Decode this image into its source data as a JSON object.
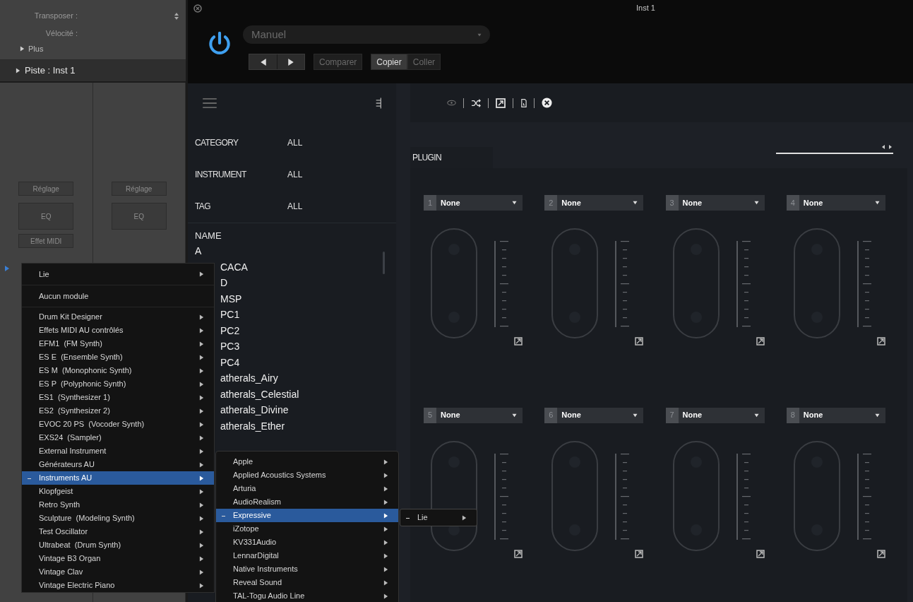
{
  "left_panel": {
    "rows": [
      {
        "label": "Transposer :",
        "stepper": true
      },
      {
        "label": "Vélocité :",
        "stepper": false
      }
    ],
    "more": {
      "label": "Plus",
      "expanded": false
    },
    "track_header": {
      "label": "Piste : Inst 1",
      "expanded": false
    },
    "strips": [
      {
        "buttons": [
          "Réglage",
          "EQ",
          "Effet MIDI"
        ]
      },
      {
        "buttons": [
          "Réglage",
          "EQ"
        ]
      }
    ]
  },
  "plugin_window": {
    "title": "Inst 1",
    "power_on": true,
    "preset": "Manuel",
    "buttons": [
      {
        "label": "Comparer",
        "selected": false
      },
      {
        "label": "Copier",
        "selected": true
      },
      {
        "label": "Coller",
        "selected": false
      }
    ],
    "browser": {
      "filters": [
        {
          "label": "CATEGORY",
          "value": "ALL"
        },
        {
          "label": "INSTRUMENT",
          "value": "ALL"
        },
        {
          "label": "TAG",
          "value": "ALL"
        }
      ],
      "list_header": "NAME",
      "names": [
        "A",
        "CACA",
        "D",
        "MSP",
        "PC1",
        "PC2",
        "PC3",
        "PC4",
        "atherals_Airy",
        "atherals_Celestial",
        "atherals_Divine",
        "atherals_Ether"
      ]
    },
    "tab": {
      "label": "PLUGIN",
      "selected": true
    },
    "slots": [
      {
        "number": "1",
        "plugin": "None"
      },
      {
        "number": "2",
        "plugin": "None"
      },
      {
        "number": "3",
        "plugin": "None"
      },
      {
        "number": "4",
        "plugin": "None"
      },
      {
        "number": "5",
        "plugin": "None"
      },
      {
        "number": "6",
        "plugin": "None"
      },
      {
        "number": "7",
        "plugin": "None"
      },
      {
        "number": "8",
        "plugin": "None"
      }
    ]
  },
  "main_menu": {
    "sections": [
      [
        {
          "label": "Lie",
          "submenu": true,
          "selected": false,
          "marked": false
        }
      ],
      [
        {
          "label": "Aucun module",
          "submenu": false,
          "selected": false,
          "marked": false
        }
      ],
      [
        {
          "label": "Drum Kit Designer",
          "submenu": true,
          "selected": false,
          "marked": false
        },
        {
          "label": "Effets MIDI AU contrôlés",
          "submenu": true,
          "selected": false,
          "marked": false
        },
        {
          "label": "EFM1  (FM Synth)",
          "submenu": true,
          "selected": false,
          "marked": false
        },
        {
          "label": "ES E  (Ensemble Synth)",
          "submenu": true,
          "selected": false,
          "marked": false
        },
        {
          "label": "ES M  (Monophonic Synth)",
          "submenu": true,
          "selected": false,
          "marked": false
        },
        {
          "label": "ES P  (Polyphonic Synth)",
          "submenu": true,
          "selected": false,
          "marked": false
        },
        {
          "label": "ES1  (Synthesizer 1)",
          "submenu": true,
          "selected": false,
          "marked": false
        },
        {
          "label": "ES2  (Synthesizer 2)",
          "submenu": true,
          "selected": false,
          "marked": false
        },
        {
          "label": "EVOC 20 PS  (Vocoder Synth)",
          "submenu": true,
          "selected": false,
          "marked": false
        },
        {
          "label": "EXS24  (Sampler)",
          "submenu": true,
          "selected": false,
          "marked": false
        },
        {
          "label": "External Instrument",
          "submenu": true,
          "selected": false,
          "marked": false
        },
        {
          "label": "Générateurs AU",
          "submenu": true,
          "selected": false,
          "marked": false
        },
        {
          "label": "Instruments AU",
          "submenu": true,
          "selected": true,
          "marked": true
        },
        {
          "label": "Klopfgeist",
          "submenu": true,
          "selected": false,
          "marked": false
        },
        {
          "label": "Retro Synth",
          "submenu": true,
          "selected": false,
          "marked": false
        },
        {
          "label": "Sculpture  (Modeling Synth)",
          "submenu": true,
          "selected": false,
          "marked": false
        },
        {
          "label": "Test Oscillator",
          "submenu": true,
          "selected": false,
          "marked": false
        },
        {
          "label": "Ultrabeat  (Drum Synth)",
          "submenu": true,
          "selected": false,
          "marked": false
        },
        {
          "label": "Vintage B3 Organ",
          "submenu": true,
          "selected": false,
          "marked": false
        },
        {
          "label": "Vintage Clav",
          "submenu": true,
          "selected": false,
          "marked": false
        },
        {
          "label": "Vintage Electric Piano",
          "submenu": true,
          "selected": false,
          "marked": false
        }
      ]
    ]
  },
  "vendor_menu": {
    "items": [
      {
        "label": "Apple",
        "submenu": true,
        "selected": false,
        "marked": false
      },
      {
        "label": "Applied Acoustics Systems",
        "submenu": true,
        "selected": false,
        "marked": false
      },
      {
        "label": "Arturia",
        "submenu": true,
        "selected": false,
        "marked": false
      },
      {
        "label": "AudioRealism",
        "submenu": true,
        "selected": false,
        "marked": false
      },
      {
        "label": "Expressive",
        "submenu": true,
        "selected": true,
        "marked": true
      },
      {
        "label": "iZotope",
        "submenu": true,
        "selected": false,
        "marked": false
      },
      {
        "label": "KV331Audio",
        "submenu": true,
        "selected": false,
        "marked": false
      },
      {
        "label": "LennarDigital",
        "submenu": true,
        "selected": false,
        "marked": false
      },
      {
        "label": "Native Instruments",
        "submenu": true,
        "selected": false,
        "marked": false
      },
      {
        "label": "Reveal Sound",
        "submenu": true,
        "selected": false,
        "marked": false
      },
      {
        "label": "TAL-Togu Audio Line",
        "submenu": true,
        "selected": false,
        "marked": false
      }
    ]
  },
  "mode_menu": {
    "items": [
      {
        "label": "Lie",
        "submenu": true,
        "selected": false,
        "marked": true
      }
    ]
  }
}
